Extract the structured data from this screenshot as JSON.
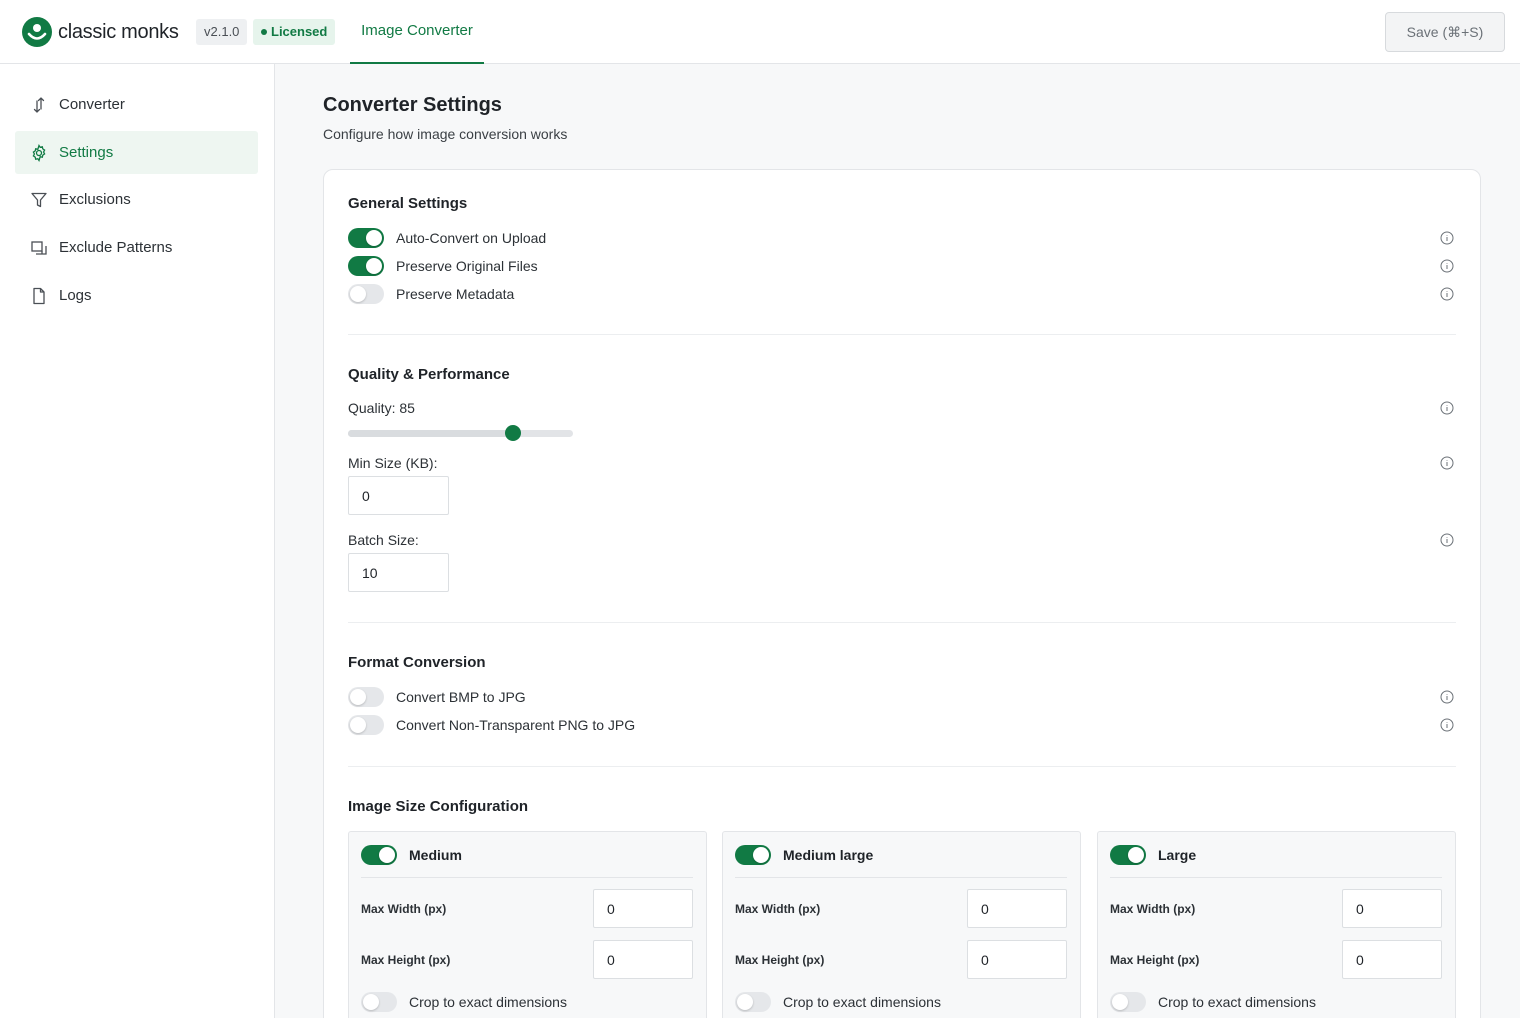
{
  "header": {
    "brand": "classic monks",
    "version": "v2.1.0",
    "license": "Licensed",
    "tab": "Image Converter",
    "save_label": "Save (⌘+S)"
  },
  "sidebar": {
    "items": [
      {
        "label": "Converter",
        "icon": "convert-arrows-icon",
        "active": false
      },
      {
        "label": "Settings",
        "icon": "gear-icon",
        "active": true
      },
      {
        "label": "Exclusions",
        "icon": "filter-icon",
        "active": false
      },
      {
        "label": "Exclude Patterns",
        "icon": "copy-icon",
        "active": false
      },
      {
        "label": "Logs",
        "icon": "file-icon",
        "active": false
      }
    ]
  },
  "page": {
    "title": "Converter Settings",
    "subtitle": "Configure how image conversion works"
  },
  "general": {
    "title": "General Settings",
    "options": [
      {
        "label": "Auto-Convert on Upload",
        "enabled": true
      },
      {
        "label": "Preserve Original Files",
        "enabled": true
      },
      {
        "label": "Preserve Metadata",
        "enabled": false
      }
    ]
  },
  "quality": {
    "title": "Quality & Performance",
    "quality_label": "Quality: 85",
    "quality_value": 85,
    "min_size_label": "Min Size (KB):",
    "min_size_value": "0",
    "batch_label": "Batch Size:",
    "batch_value": "10"
  },
  "format": {
    "title": "Format Conversion",
    "options": [
      {
        "label": "Convert BMP to JPG",
        "enabled": false
      },
      {
        "label": "Convert Non-Transparent PNG to JPG",
        "enabled": false
      }
    ]
  },
  "sizes": {
    "title": "Image Size Configuration",
    "max_width_label": "Max Width (px)",
    "max_height_label": "Max Height (px)",
    "crop_label": "Crop to exact dimensions",
    "items": [
      {
        "name": "Medium",
        "enabled": true,
        "max_width": "0",
        "max_height": "0",
        "crop": false
      },
      {
        "name": "Medium large",
        "enabled": true,
        "max_width": "0",
        "max_height": "0",
        "crop": false
      },
      {
        "name": "Large",
        "enabled": true,
        "max_width": "0",
        "max_height": "0",
        "crop": false
      }
    ]
  },
  "colors": {
    "accent": "#117a44",
    "toggle_off": "#e5e7ea"
  }
}
